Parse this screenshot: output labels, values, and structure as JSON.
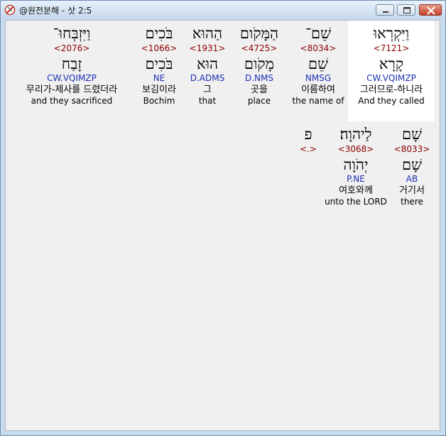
{
  "window": {
    "title": "@원전분해 - 삿 2:5"
  },
  "words": [
    {
      "heb": "וַיִּקְרְאוּ",
      "strong": "<7121>",
      "lemma": "קָרָא",
      "morph": "CW.VQIMZP",
      "kor": "그러므로-하니라",
      "eng": "And they called"
    },
    {
      "heb": "שֵׁם־",
      "strong": "<8034>",
      "lemma": "שֵׁם",
      "morph": "NMSG",
      "kor": "이름하여",
      "eng": "the name of"
    },
    {
      "heb": "הַמָּקֹום",
      "strong": "<4725>",
      "lemma": "מָקֹום",
      "morph": "D.NMS",
      "kor": "곳을",
      "eng": "place"
    },
    {
      "heb": "הַהוּא",
      "strong": "<1931>",
      "lemma": "הוּא",
      "morph": "D.ADMS",
      "kor": "그",
      "eng": "that"
    },
    {
      "heb": "בֹּכִים",
      "strong": "<1066>",
      "lemma": "בֹּכִים",
      "morph": "NE",
      "kor": "보김이라",
      "eng": "Bochim"
    },
    {
      "heb": "וַיִּזְבְּחוּ־",
      "strong": "<2076>",
      "lemma": "זָבַח",
      "morph": "CW.VQIMZP",
      "kor": "무리가-제사를 드렸더라",
      "eng": "and they sacrificed"
    },
    {
      "heb": "שָׁם",
      "strong": "<8033>",
      "lemma": "שָׁם",
      "morph": "AB",
      "kor": "거기서",
      "eng": "there"
    },
    {
      "heb": "לַיהוָה׃",
      "strong": "<3068>",
      "lemma": "יְהֹוָה",
      "morph": "P.NE",
      "kor": "여호와께",
      "eng": "unto the LORD"
    },
    {
      "heb": "פ",
      "strong": "<.>",
      "lemma": "",
      "morph": "",
      "kor": "",
      "eng": ""
    }
  ]
}
